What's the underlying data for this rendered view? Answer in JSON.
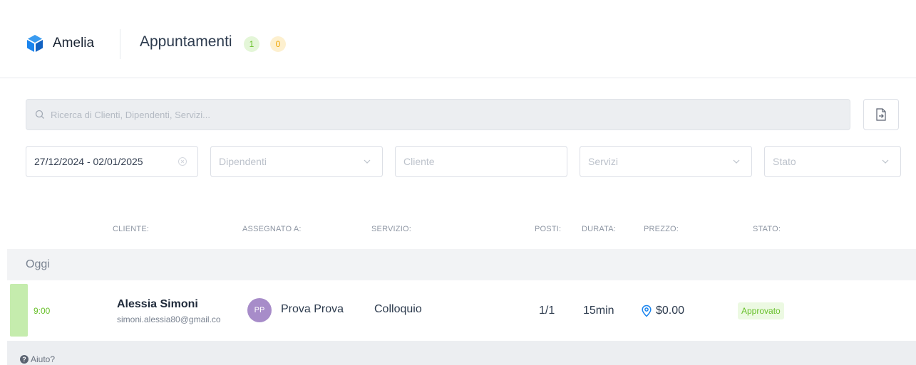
{
  "header": {
    "logo_text": "Amelia",
    "title": "Appuntamenti",
    "badge_approved_count": "1",
    "badge_pending_count": "0"
  },
  "search": {
    "placeholder": "Ricerca di Clienti, Dipendenti, Servizi..."
  },
  "filters": {
    "date_range": "27/12/2024 - 02/01/2025",
    "employees_placeholder": "Dipendenti",
    "customer_placeholder": "Cliente",
    "services_placeholder": "Servizi",
    "status_placeholder": "Stato"
  },
  "table": {
    "columns": {
      "customer": "CLIENTE:",
      "assigned": "ASSEGNATO A:",
      "service": "SERVIZIO:",
      "seats": "POSTI:",
      "duration": "DURATA:",
      "price": "PREZZO:",
      "status": "STATO:"
    },
    "group_label": "Oggi",
    "rows": [
      {
        "time": "9:00",
        "customer_name": "Alessia Simoni",
        "customer_email": "simoni.alessia80@gmail.co",
        "employee_initials": "PP",
        "employee_name": "Prova Prova",
        "service": "Colloquio",
        "seats": "1/1",
        "duration": "15min",
        "price": "$0.00",
        "status": "Approvato"
      }
    ]
  },
  "footer": {
    "help_label": "Aiuto?"
  },
  "colors": {
    "brand_blue": "#1a84ee",
    "approved_green": "#69c02b",
    "pending_yellow": "#f0a500",
    "avatar_purple": "#a78cc9"
  },
  "icons": {
    "logo": "amelia-logo-icon",
    "search": "search-icon",
    "export": "export-icon",
    "clear": "clear-icon",
    "dropdown": "chevron-down-icon",
    "location": "location-pin-icon",
    "help": "help-icon"
  }
}
